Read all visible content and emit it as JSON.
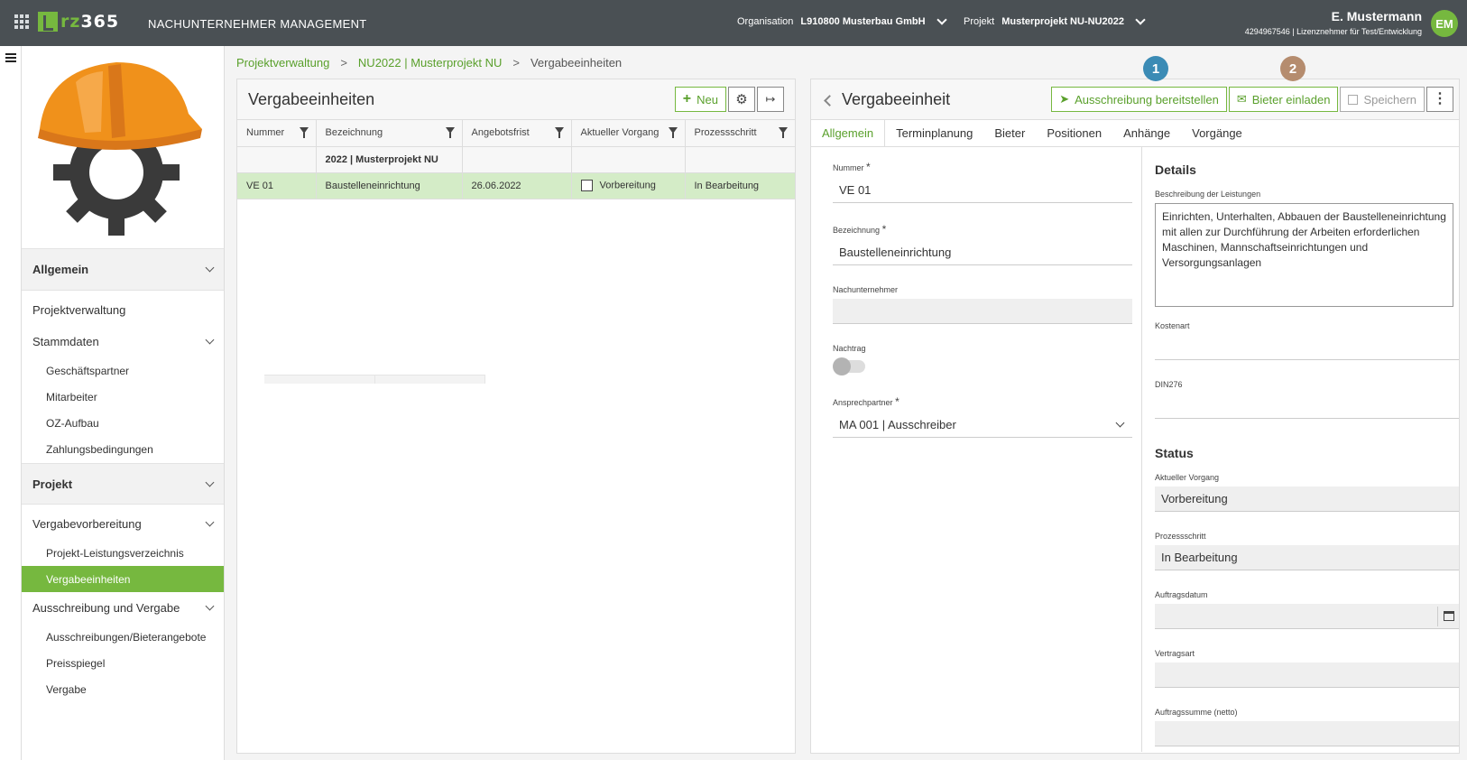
{
  "topbar": {
    "logo_text_a": "rz",
    "logo_text_b": "365",
    "app_title": "NACHUNTERNEHMER MANAGEMENT",
    "org_label": "Organisation",
    "org_value": "L910800 Musterbau GmbH",
    "proj_label": "Projekt",
    "proj_value": "Musterprojekt NU-NU2022",
    "user_name": "E. Mustermann",
    "user_sub": "4294967546 | Lizenznehmer für Test/Entwicklung",
    "avatar": "EM"
  },
  "sidebar": {
    "sections": [
      {
        "label": "Allgemein"
      },
      {
        "label": "Projekt"
      }
    ],
    "allgemein_items": {
      "projektverwaltung": "Projektverwaltung",
      "stammdaten": "Stammdaten",
      "geschaeftspartner": "Geschäftspartner",
      "mitarbeiter": "Mitarbeiter",
      "oz": "OZ-Aufbau",
      "zahlung": "Zahlungsbedingungen"
    },
    "projekt_items": {
      "vergabevorbereitung": "Vergabevorbereitung",
      "plv": "Projekt-Leistungsverzeichnis",
      "vergabeeinheiten": "Vergabeeinheiten",
      "ausschreibung": "Ausschreibung und Vergabe",
      "ausschreibungen": "Ausschreibungen/Bieterangebote",
      "preisspiegel": "Preisspiegel",
      "vergabe": "Vergabe"
    }
  },
  "breadcrumb": [
    "Projektverwaltung",
    "NU2022 | Musterprojekt NU",
    "Vergabeeinheiten"
  ],
  "list": {
    "title": "Vergabeeinheiten",
    "new_label": "Neu",
    "columns": [
      "Nummer",
      "Bezeichnung",
      "Angebotsfrist",
      "Aktueller Vorgang",
      "Prozessschritt"
    ],
    "group_label": "2022 | Musterprojekt NU",
    "rows": [
      {
        "nummer": "VE 01",
        "bezeichnung": "Baustelleneinrichtung",
        "frist": "26.06.2022",
        "vorgang": "Vorbereitung",
        "schritt": "In Bearbeitung"
      }
    ]
  },
  "detail": {
    "title": "Vergabeeinheit",
    "btn_ausschreibung": "Ausschreibung bereitstellen",
    "btn_bieter": "Bieter einladen",
    "btn_speichern": "Speichern",
    "badge1": "1",
    "badge2": "2",
    "badge1_color": "#3b8bb5",
    "badge2_color": "#b58c6e",
    "tabs": [
      "Allgemein",
      "Terminplanung",
      "Bieter",
      "Positionen",
      "Anhänge",
      "Vorgänge"
    ],
    "fields": {
      "nummer_label": "Nummer",
      "nummer_value": "VE 01",
      "bezeichnung_label": "Bezeichnung",
      "bezeichnung_value": "Baustelleneinrichtung",
      "nu_label": "Nachunternehmer",
      "nachtrag_label": "Nachtrag",
      "ansprech_label": "Ansprechpartner",
      "ansprech_value": "MA 001 | Ausschreiber",
      "required_mark": "*"
    },
    "details": {
      "title": "Details",
      "beschr_label": "Beschreibung der Leistungen",
      "beschr_value": "Einrichten, Unterhalten, Abbauen der Baustelleneinrichtung mit allen zur Durchführung der Arbeiten erforderlichen Maschinen, Mannschaftseinrichtungen und Versorgungsanlagen",
      "kostenart_label": "Kostenart",
      "din_label": "DIN276"
    },
    "status": {
      "title": "Status",
      "vorgang_label": "Aktueller Vorgang",
      "vorgang_value": "Vorbereitung",
      "schritt_label": "Prozessschritt",
      "schritt_value": "In Bearbeitung",
      "datum_label": "Auftragsdatum",
      "art_label": "Vertragsart",
      "summe_label": "Auftragssumme (netto)"
    }
  },
  "colors": {
    "accent": "#76b83f",
    "topbar": "#4a5054",
    "selected_row": "#d4ecc7"
  }
}
